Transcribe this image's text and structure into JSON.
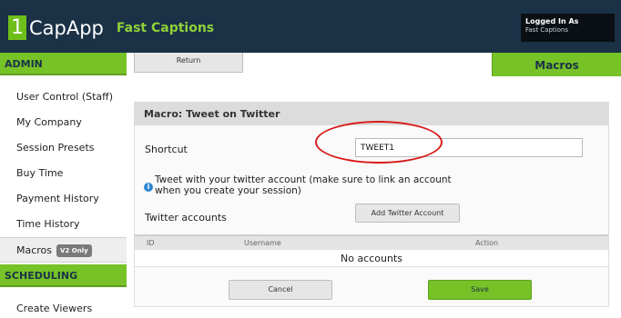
{
  "header": {
    "logo_number": "1",
    "logo_name": "CapApp",
    "tagline": "Fast Captions",
    "login_title": "Logged In As",
    "login_user": "Fast Captions"
  },
  "sidebar": {
    "admin_heading": "ADMIN",
    "items": [
      {
        "label": "User Control (Staff)"
      },
      {
        "label": "My Company"
      },
      {
        "label": "Session Presets"
      },
      {
        "label": "Buy Time"
      },
      {
        "label": "Payment History"
      },
      {
        "label": "Time History"
      },
      {
        "label": "Macros",
        "badge": "V2 Only"
      }
    ],
    "scheduling_heading": "SCHEDULING",
    "scheduling_items": [
      {
        "label": "Create Viewers"
      }
    ]
  },
  "toolbar": {
    "return_label": "Return",
    "active_tab": "Macros"
  },
  "macro": {
    "title": "Macro: Tweet on Twitter",
    "shortcut_label": "Shortcut",
    "shortcut_value": "TWEET1",
    "info_text": "Tweet with your twitter account (make sure to link an account when you create your session)",
    "twitter_accounts_label": "Twitter accounts",
    "add_account_label": "Add Twitter Account",
    "table": {
      "columns": [
        "ID",
        "Username",
        "Action"
      ],
      "empty_text": "No accounts"
    },
    "cancel_label": "Cancel",
    "save_label": "Save"
  },
  "colors": {
    "header_bg": "#1a3146",
    "accent_green": "#77c227",
    "annotation_red": "#d81b1b",
    "info_blue": "#2d86d1"
  },
  "icons": [
    "info-icon"
  ]
}
